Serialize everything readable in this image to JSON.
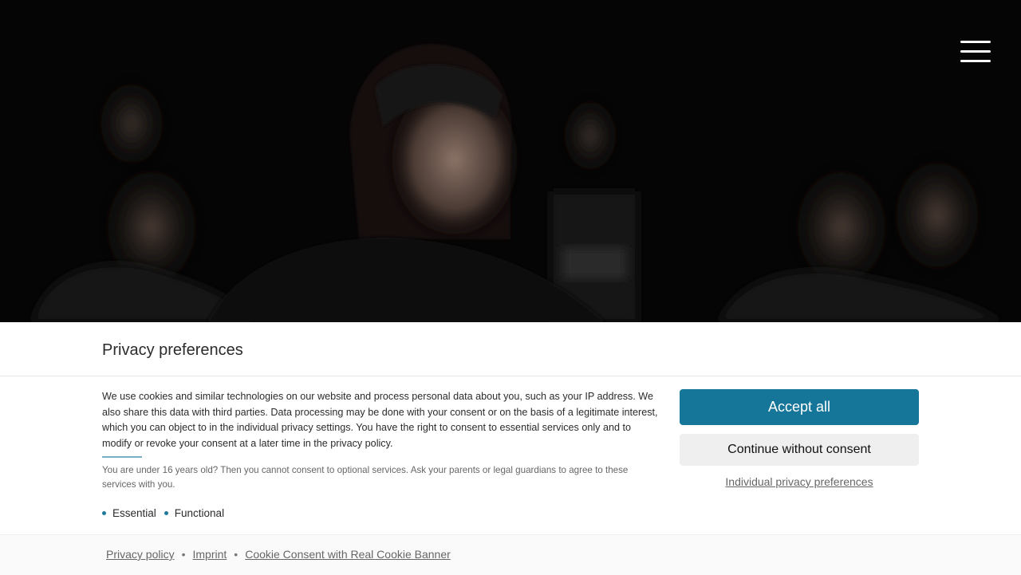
{
  "hero": {
    "image_alt": "children singing on stage"
  },
  "menu": {
    "icon": "hamburger-menu-icon"
  },
  "banner": {
    "title": "Privacy preferences",
    "text": "We use cookies and similar technologies on our website and process personal data about you, such as your IP address. We also share this data with third parties. Data processing may be done with your consent or on the basis of a legitimate interest, which you can object to in the individual privacy settings. You have the right to consent to essential services only and to modify or revoke your consent at a later time in the privacy policy.",
    "note": "You are under 16 years old? Then you cannot consent to optional services. Ask your parents or legal guardians to agree to these services with you.",
    "groups": [
      "Essential",
      "Functional"
    ],
    "accept_label": "Accept all",
    "continue_label": "Continue without consent",
    "individual_label": "Individual privacy preferences"
  },
  "footer": {
    "links": [
      "Privacy policy",
      "Imprint",
      "Cookie Consent with Real Cookie Banner"
    ],
    "separator": "•"
  },
  "colors": {
    "accent": "#15769a",
    "banner_bg": "#ffffff",
    "hero_bg": "#050505"
  }
}
